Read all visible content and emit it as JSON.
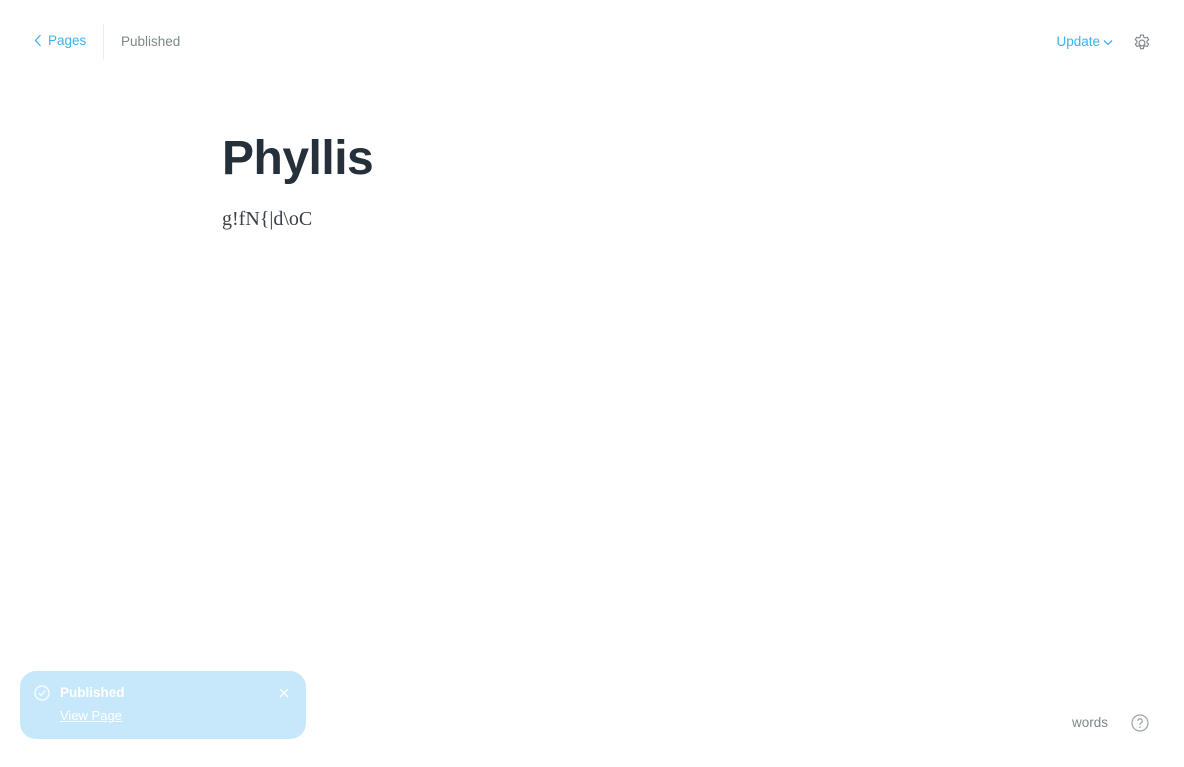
{
  "header": {
    "back_label": "Pages",
    "status": "Published",
    "update_label": "Update"
  },
  "editor": {
    "title": "Phyllis",
    "body": "g!fN{|d\\oC"
  },
  "notification": {
    "title": "Published",
    "link_label": "View Page"
  },
  "footer": {
    "word_count_label": "words"
  },
  "colors": {
    "accent": "#3eb0ef",
    "muted": "#7d878a",
    "toast_bg": "#c7e8fb"
  },
  "icons": [
    "chevron-left-icon",
    "chevron-down-icon",
    "gear-icon",
    "check-circle-icon",
    "close-icon",
    "help-circle-icon"
  ]
}
